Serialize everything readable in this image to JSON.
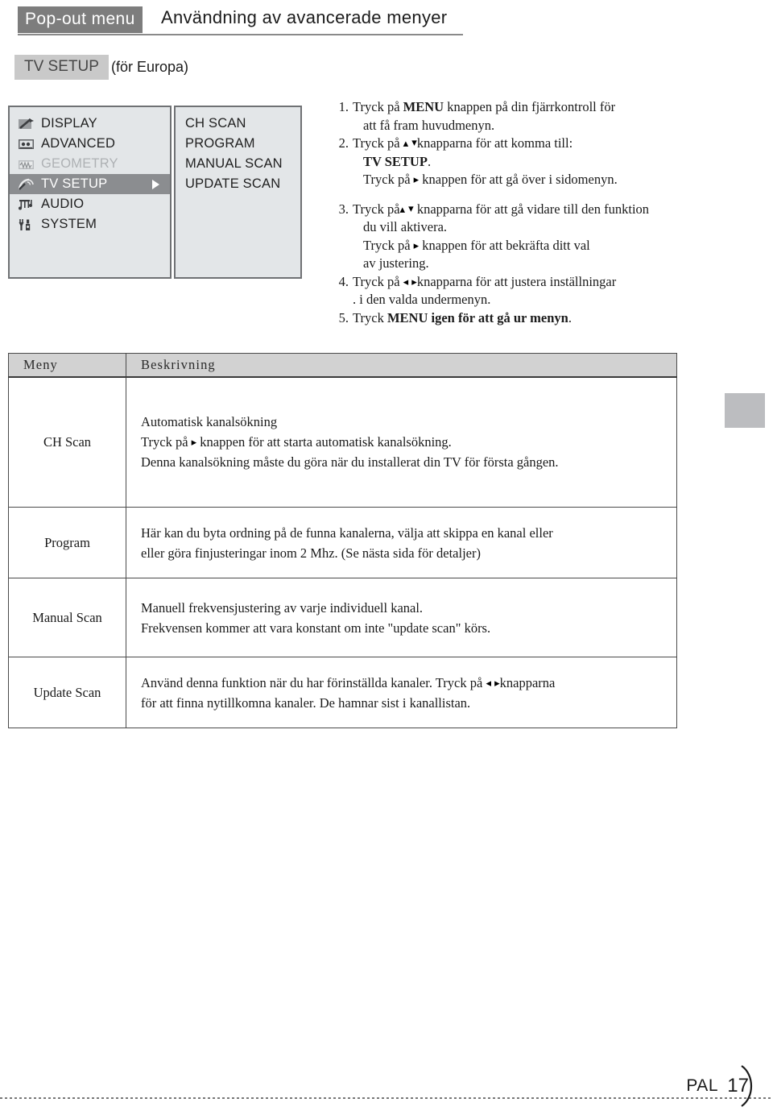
{
  "header": {
    "tag": "Pop-out menu",
    "title": "Användning av avancerade menyer"
  },
  "subtitle": {
    "badge": "TV SETUP",
    "note": "(för Europa)"
  },
  "osd": {
    "main_menu": [
      {
        "label": "DISPLAY",
        "icon": "display-icon",
        "state": "normal"
      },
      {
        "label": "ADVANCED",
        "icon": "advanced-icon",
        "state": "normal"
      },
      {
        "label": "GEOMETRY",
        "icon": "geometry-icon",
        "state": "disabled"
      },
      {
        "label": "TV SETUP",
        "icon": "tv-setup-icon",
        "state": "selected"
      },
      {
        "label": "AUDIO",
        "icon": "audio-icon",
        "state": "normal"
      },
      {
        "label": "SYSTEM",
        "icon": "system-icon",
        "state": "normal"
      }
    ],
    "sub_menu": [
      {
        "label": "CH SCAN"
      },
      {
        "label": "PROGRAM"
      },
      {
        "label": "MANUAL SCAN"
      },
      {
        "label": "UPDATE SCAN"
      }
    ],
    "selected_arrow": "triangle-right-icon",
    "colors": {
      "panel_bg": "#e3e6e8",
      "panel_border": "#6f7174",
      "highlight": "#8b8d90",
      "disabled_text": "#aeb1b4"
    }
  },
  "steps": [
    {
      "num": "1.",
      "lines": [
        {
          "segments": [
            {
              "t": "Tryck på "
            },
            {
              "t": "MENU",
              "bold": true
            },
            {
              "t": " knappen på din fjärrkontroll för"
            }
          ]
        },
        {
          "indent": true,
          "segments": [
            {
              "t": "att få fram huvudmenyn."
            }
          ]
        }
      ]
    },
    {
      "num": "2.",
      "lines": [
        {
          "segments": [
            {
              "t": "Tryck på "
            },
            {
              "arrow": "up"
            },
            {
              "t": " "
            },
            {
              "arrow": "down"
            },
            {
              "t": "knapparna för att komma till:"
            }
          ]
        },
        {
          "indent": true,
          "segments": [
            {
              "t": "TV SETUP",
              "bold": true
            },
            {
              "t": "."
            }
          ]
        },
        {
          "indent": true,
          "segments": [
            {
              "t": "Tryck på "
            },
            {
              "arrow": "right"
            },
            {
              "t": " knappen för att gå över i sidomenyn."
            }
          ]
        }
      ]
    },
    {
      "num": "3.",
      "spacer_before": true,
      "lines": [
        {
          "segments": [
            {
              "t": "Tryck på"
            },
            {
              "arrow": "up"
            },
            {
              "t": " "
            },
            {
              "arrow": "down"
            },
            {
              "t": " knapparna för att gå vidare till den funktion"
            }
          ]
        },
        {
          "indent": true,
          "segments": [
            {
              "t": " du vill aktivera."
            }
          ]
        },
        {
          "indent": true,
          "segments": [
            {
              "t": "Tryck på "
            },
            {
              "arrow": "right"
            },
            {
              "t": " knappen för att bekräfta ditt val"
            }
          ]
        },
        {
          "indent": true,
          "segments": [
            {
              "t": "av justering."
            }
          ]
        }
      ]
    },
    {
      "num": "4.",
      "lines": [
        {
          "segments": [
            {
              "t": "Tryck på "
            },
            {
              "arrow": "left"
            },
            {
              "t": "  "
            },
            {
              "arrow": "right"
            },
            {
              "t": "knapparna för att justera inställningar"
            }
          ]
        },
        {
          "segments": [
            {
              "t": ". i den valda undermenyn."
            }
          ]
        }
      ]
    },
    {
      "num": "5.",
      "lines": [
        {
          "segments": [
            {
              "t": "Tryck "
            },
            {
              "t": "MENU igen för att gå ur menyn",
              "bold": true
            },
            {
              "t": "."
            }
          ]
        }
      ]
    }
  ],
  "table": {
    "headers": [
      "Meny",
      "Beskrivning"
    ],
    "rows": [
      {
        "menu": "CH Scan",
        "lines": [
          {
            "segments": [
              {
                "t": "Automatisk kanalsökning"
              }
            ]
          },
          {
            "segments": [
              {
                "t": "Tryck på "
              },
              {
                "arrow": "right"
              },
              {
                "t": " knappen för att starta automatisk kanalsökning."
              }
            ]
          },
          {
            "segments": [
              {
                "t": "Denna kanalsökning måste du göra när du installerat din TV för första gången."
              }
            ]
          }
        ]
      },
      {
        "menu": "Program",
        "lines": [
          {
            "segments": [
              {
                "t": "Här kan du byta ordning på de funna kanalerna, välja att skippa en kanal eller"
              }
            ]
          },
          {
            "segments": [
              {
                "t": "eller göra finjusteringar inom 2 Mhz. (Se nästa sida för detaljer)"
              }
            ]
          }
        ]
      },
      {
        "menu": "Manual Scan",
        "lines": [
          {
            "segments": [
              {
                "t": "Manuell frekvensjustering av varje individuell kanal."
              }
            ]
          },
          {
            "segments": [
              {
                "t": "Frekvensen kommer att vara konstant om inte \"update scan\" körs."
              }
            ]
          }
        ]
      },
      {
        "menu": "Update Scan",
        "lines": [
          {
            "segments": [
              {
                "t": "Använd denna funktion när du har förinställda kanaler. Tryck på  "
              },
              {
                "arrow": "left"
              },
              {
                "t": " "
              },
              {
                "arrow": "right"
              },
              {
                "t": "knapparna"
              }
            ]
          },
          {
            "segments": [
              {
                "t": "för att finna nytillkomna kanaler. De hamnar sist i kanallistan."
              }
            ]
          }
        ]
      }
    ]
  },
  "footer": {
    "standard": "PAL",
    "page_number": "17"
  }
}
